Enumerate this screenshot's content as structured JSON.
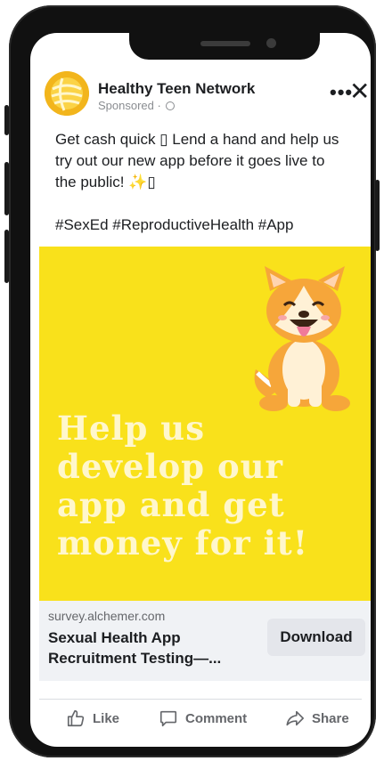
{
  "post": {
    "page_name": "Healthy Teen Network",
    "sponsored_label": "Sponsored · ",
    "text_line": "Get cash quick ▯ Lend a hand and help us try out our new app before it goes live to the public! ✨▯",
    "hashtags": "#SexEd #ReproductiveHealth #App"
  },
  "creative": {
    "headline": "Help us develop our app and get money for it!",
    "background_color": "#f9e11b"
  },
  "link": {
    "domain": "survey.alchemer.com",
    "title": "Sexual Health App Recruitment Testing—...",
    "cta": "Download"
  },
  "actions": {
    "like": "Like",
    "comment": "Comment",
    "share": "Share"
  },
  "icons": {
    "more": "more-options-icon",
    "close": "close-icon",
    "globe": "globe-icon",
    "like": "thumbs-up-icon",
    "comment": "comment-icon",
    "share": "share-arrow-icon"
  }
}
